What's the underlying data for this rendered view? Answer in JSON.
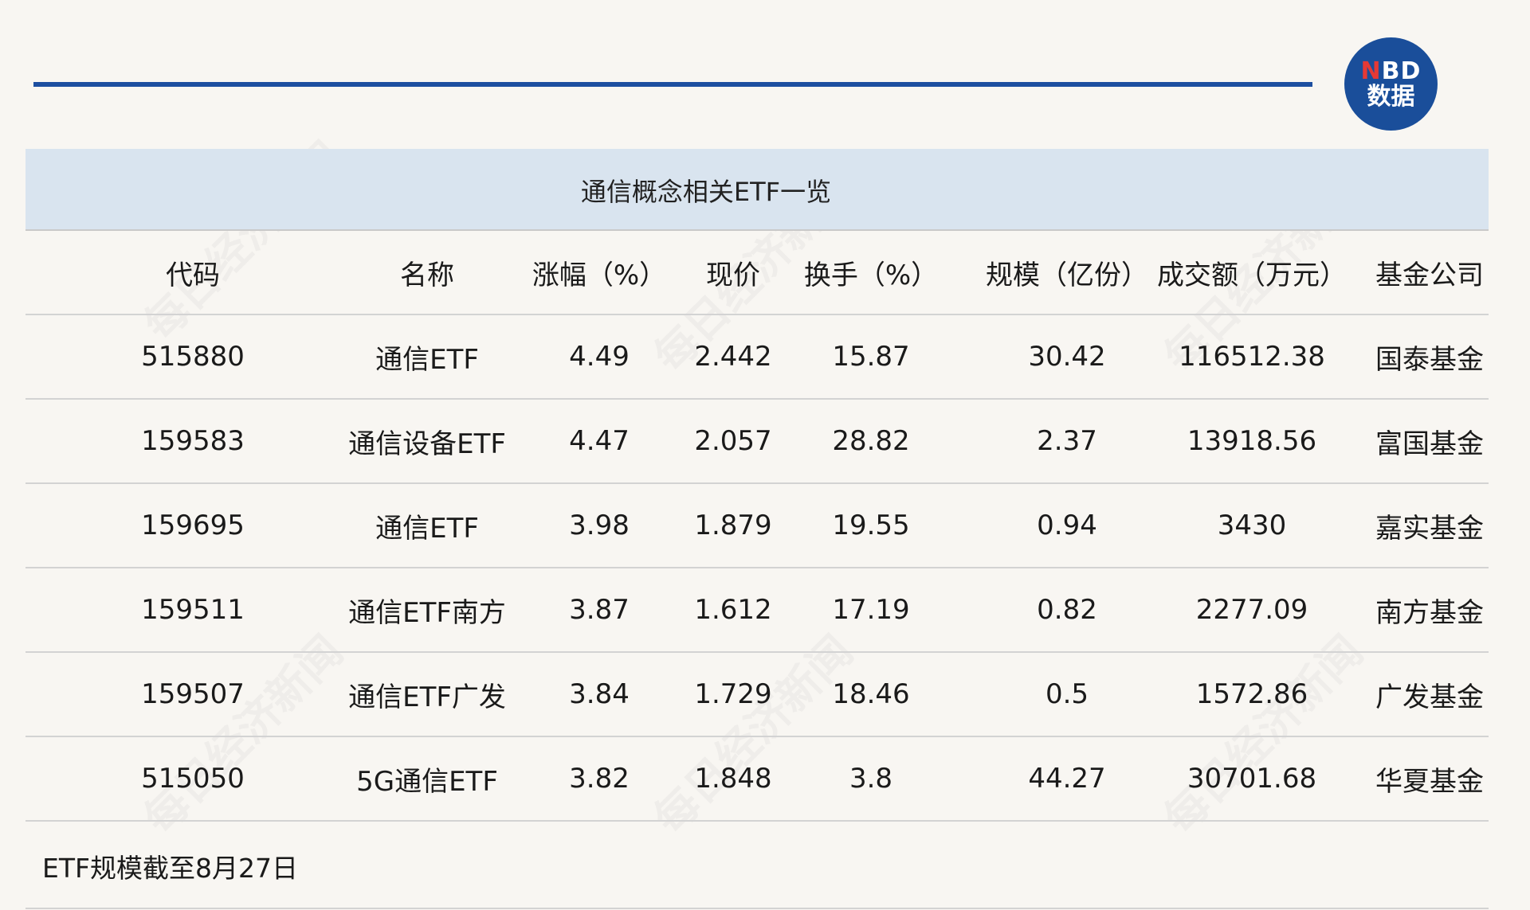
{
  "logo": {
    "line1_n": "N",
    "line1_rest": "BD",
    "line2": "数据"
  },
  "watermark_text": "每日经济新闻",
  "table": {
    "title": "通信概念相关ETF一览",
    "headers": [
      "代码",
      "名称",
      "涨幅（%）",
      "现价",
      "换手（%）",
      "规模（亿份）",
      "成交额（万元）",
      "基金公司"
    ],
    "rows": [
      [
        "515880",
        "通信ETF",
        "4.49",
        "2.442",
        "15.87",
        "30.42",
        "116512.38",
        "国泰基金"
      ],
      [
        "159583",
        "通信设备ETF",
        "4.47",
        "2.057",
        "28.82",
        "2.37",
        "13918.56",
        "富国基金"
      ],
      [
        "159695",
        "通信ETF",
        "3.98",
        "1.879",
        "19.55",
        "0.94",
        "3430",
        "嘉实基金"
      ],
      [
        "159511",
        "通信ETF南方",
        "3.87",
        "1.612",
        "17.19",
        "0.82",
        "2277.09",
        "南方基金"
      ],
      [
        "159507",
        "通信ETF广发",
        "3.84",
        "1.729",
        "18.46",
        "0.5",
        "1572.86",
        "广发基金"
      ],
      [
        "515050",
        "5G通信ETF",
        "3.82",
        "1.848",
        "3.8",
        "44.27",
        "30701.68",
        "华夏基金"
      ]
    ],
    "note": "ETF规模截至8月27日"
  }
}
